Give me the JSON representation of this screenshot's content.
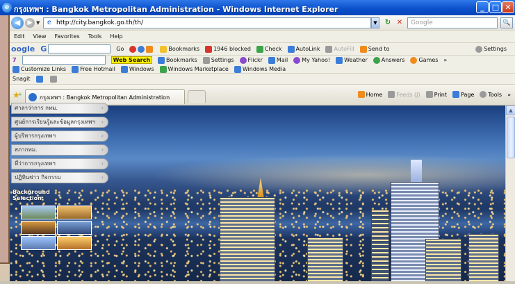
{
  "window": {
    "title": "กรุงเทพฯ : Bangkok Metropolitan Administration - Windows Internet Explorer",
    "ie_icon": "e",
    "buttons": {
      "minimize": "_",
      "maximize": "□",
      "close": "✕"
    }
  },
  "address_bar": {
    "back_glyph": "◀",
    "forward_glyph": "▶",
    "dropdown_glyph": "▼",
    "url": "http://city.bangkok.go.th/th/",
    "page_icon": "e",
    "refresh_glyph": "↻",
    "stop_glyph": "✕",
    "search_placeholder": "Google",
    "search_go_glyph": "🔍"
  },
  "menu": {
    "items": [
      "Edit",
      "View",
      "Favorites",
      "Tools",
      "Help"
    ]
  },
  "google_toolbar": {
    "logo": "oogle",
    "logo_suffix": "G",
    "go": "Go",
    "bookmarks": "Bookmarks",
    "popups_blocked": "1946 blocked",
    "check": "Check",
    "autolink": "AutoLink",
    "autofill": "AutoFill",
    "send_to": "Send to",
    "settings": "Settings"
  },
  "links_toolbar": {
    "prefix": "7",
    "web_search": "Web Search",
    "bookmarks": "Bookmarks",
    "settings": "Settings",
    "flickr": "Flickr",
    "mail": "Mail",
    "my_yahoo": "My Yahoo!",
    "weather": "Weather",
    "answers": "Answers",
    "games": "Games",
    "more": "»",
    "customize_links": "Customize Links",
    "free_hotmail": "Free Hotmail",
    "windows": "Windows",
    "windows_marketplace": "Windows Marketplace",
    "windows_media": "Windows Media"
  },
  "snagit": {
    "label": "Snagit"
  },
  "tabs": {
    "active_tab": "กรุงเทพฯ : Bangkok Metropolitan Administration"
  },
  "command_bar": {
    "home": "Home",
    "feeds": "Feeds (J)",
    "print": "Print",
    "page": "Page",
    "tools": "Tools",
    "more": "»"
  },
  "side_menu": {
    "items": [
      "ศาลาว่าการ กทม.",
      "ศูนย์การเรียนรู้และข้อมูลกรุงเทพฯ",
      "ผู้บริหารกรุงเทพฯ",
      "สภากทม.",
      "ที่ว่าการกรุงเทพฯ",
      "ปฏิทินข่าว กิจกรรม"
    ],
    "arrow": "›"
  },
  "background_selection": {
    "label_line1": "Background",
    "label_line2": "Selection:"
  },
  "scrollbar": {
    "up_glyph": "▲"
  }
}
